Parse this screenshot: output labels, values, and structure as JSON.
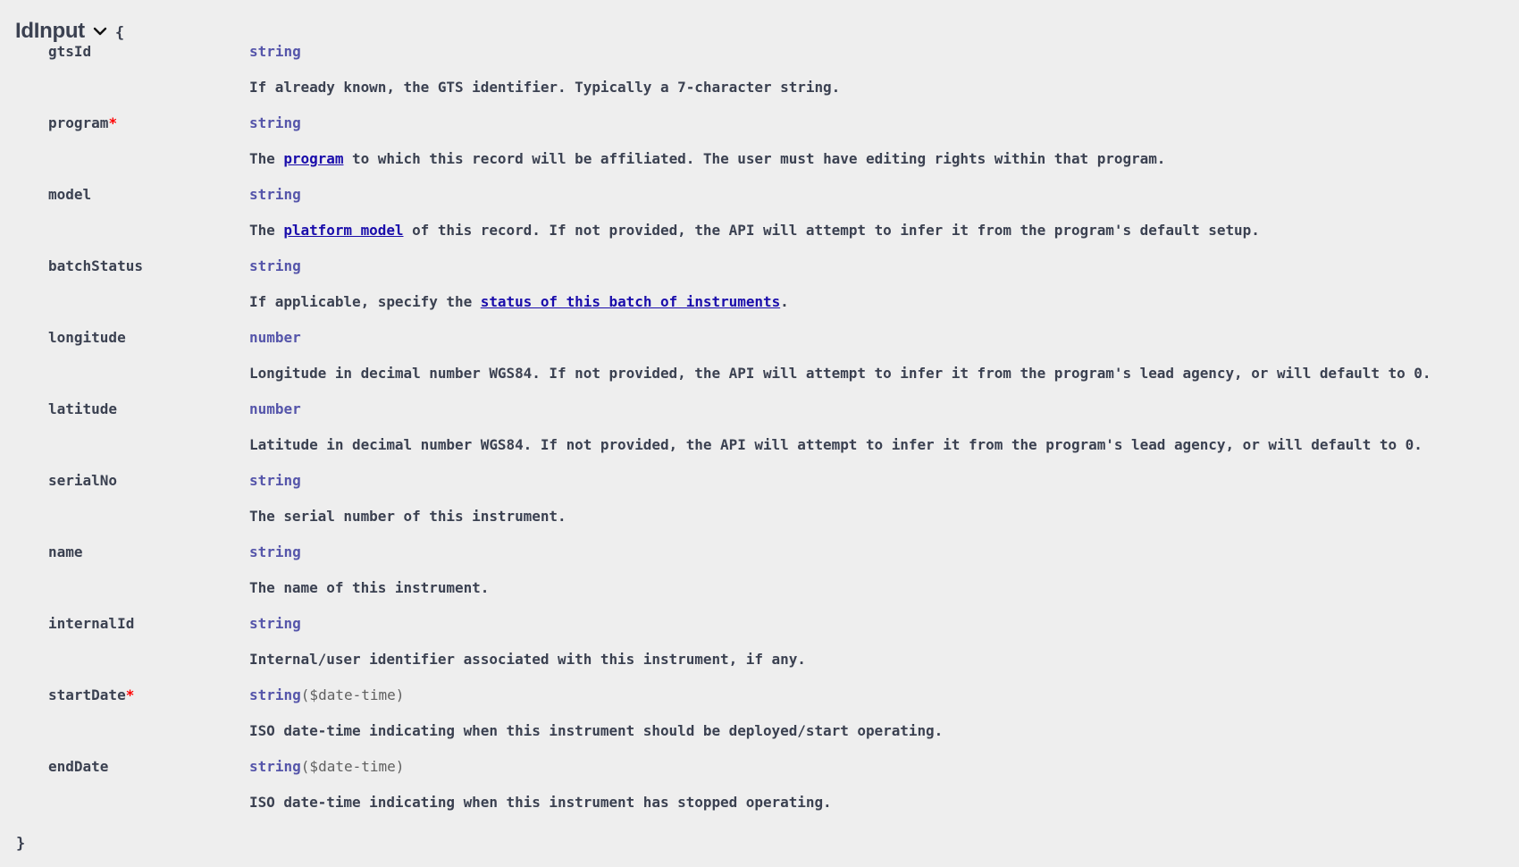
{
  "model": {
    "name": "IdInput",
    "open_brace": "{",
    "close_brace": "}",
    "toggle_icon": "chevron-down-icon"
  },
  "properties": [
    {
      "name": "gtsId",
      "required": false,
      "type": "string",
      "format": "",
      "desc": {
        "before": "If already known, the GTS identifier. Typically a 7-character string.",
        "link": "",
        "after": ""
      }
    },
    {
      "name": "program",
      "required": true,
      "required_mark": "*",
      "type": "string",
      "format": "",
      "desc": {
        "before": "The ",
        "link": "program",
        "after": " to which this record will be affiliated. The user must have editing rights within that program."
      }
    },
    {
      "name": "model",
      "required": false,
      "type": "string",
      "format": "",
      "desc": {
        "before": "The ",
        "link": "platform model",
        "after": " of this record. If not provided, the API will attempt to infer it from the program's default setup."
      }
    },
    {
      "name": "batchStatus",
      "required": false,
      "type": "string",
      "format": "",
      "desc": {
        "before": "If applicable, specify the ",
        "link": "status of this batch of instruments",
        "after": "."
      }
    },
    {
      "name": "longitude",
      "required": false,
      "type": "number",
      "format": "",
      "desc": {
        "before": "Longitude in decimal number WGS84. If not provided, the API will attempt to infer it from the program's lead agency, or will default to 0.",
        "link": "",
        "after": ""
      }
    },
    {
      "name": "latitude",
      "required": false,
      "type": "number",
      "format": "",
      "desc": {
        "before": "Latitude in decimal number WGS84. If not provided, the API will attempt to infer it from the program's lead agency, or will default to 0.",
        "link": "",
        "after": ""
      }
    },
    {
      "name": "serialNo",
      "required": false,
      "type": "string",
      "format": "",
      "desc": {
        "before": "The serial number of this instrument.",
        "link": "",
        "after": ""
      }
    },
    {
      "name": "name",
      "required": false,
      "type": "string",
      "format": "",
      "desc": {
        "before": "The name of this instrument.",
        "link": "",
        "after": ""
      }
    },
    {
      "name": "internalId",
      "required": false,
      "type": "string",
      "format": "",
      "desc": {
        "before": "Internal/user identifier associated with this instrument, if any.",
        "link": "",
        "after": ""
      }
    },
    {
      "name": "startDate",
      "required": true,
      "required_mark": "*",
      "type": "string",
      "format": "($date-time)",
      "desc": {
        "before": "ISO date-time indicating when this instrument should be deployed/start operating.",
        "link": "",
        "after": ""
      }
    },
    {
      "name": "endDate",
      "required": false,
      "type": "string",
      "format": "($date-time)",
      "desc": {
        "before": "ISO date-time indicating when this instrument has stopped operating.",
        "link": "",
        "after": ""
      }
    }
  ],
  "colors": {
    "background": "#eeeeee",
    "text": "#3b4151",
    "type": "#5555aa",
    "link": "#1a0dab",
    "required": "#ff0000"
  }
}
